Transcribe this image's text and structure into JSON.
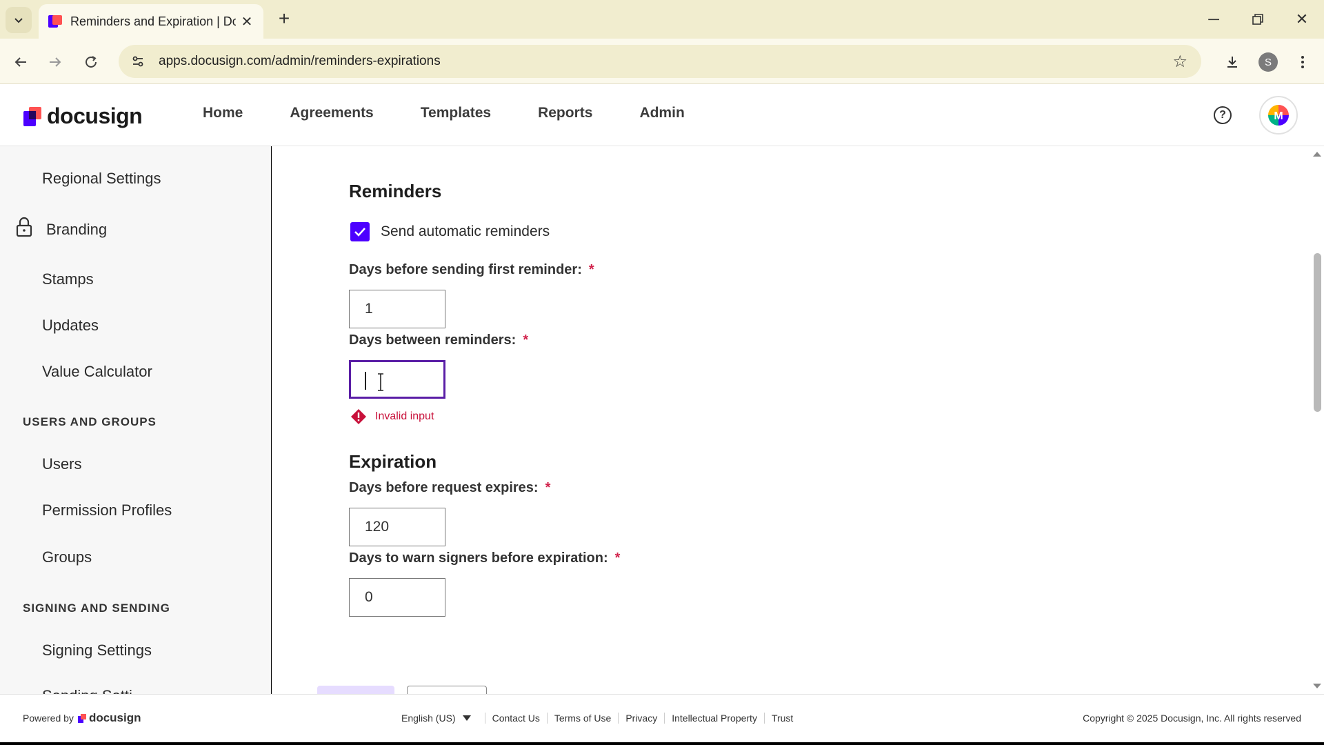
{
  "browser": {
    "tab_title": "Reminders and Expiration | Doc",
    "url": "apps.docusign.com/admin/reminders-expirations",
    "profile_initial": "S"
  },
  "header": {
    "logo_text": "docusign",
    "nav": [
      "Home",
      "Agreements",
      "Templates",
      "Reports",
      "Admin"
    ]
  },
  "sidebar": {
    "items": {
      "regional_settings": "Regional Settings",
      "branding": "Branding",
      "stamps": "Stamps",
      "updates": "Updates",
      "value_calculator": "Value Calculator",
      "users_and_groups_heading": "USERS AND GROUPS",
      "users": "Users",
      "permission_profiles": "Permission Profiles",
      "groups": "Groups",
      "signing_and_sending_heading": "SIGNING AND SENDING",
      "signing_settings": "Signing Settings",
      "sending_settings_partial": "Sending Setti"
    }
  },
  "reminders": {
    "heading": "Reminders",
    "auto_label": "Send automatic reminders",
    "auto_checked": true,
    "first_label": "Days before sending first reminder:",
    "first_value": "1",
    "between_label": "Days between reminders:",
    "between_value": "",
    "error_text": "Invalid input"
  },
  "expiration": {
    "heading": "Expiration",
    "expires_label": "Days before request expires:",
    "expires_value": "120",
    "warn_label": "Days to warn signers before expiration:",
    "warn_value": "0"
  },
  "required_mark": "*",
  "footer": {
    "powered_by": "Powered by",
    "brand": "docusign",
    "language": "English (US)",
    "links": [
      "Contact Us",
      "Terms of Use",
      "Privacy",
      "Intellectual Property",
      "Trust"
    ],
    "copyright": "Copyright © 2025 Docusign, Inc. All rights reserved"
  },
  "colors": {
    "accent": "#4c00ff",
    "focus_border": "#5a1ea6",
    "error": "#c8103a",
    "required": "#d1224b",
    "chrome_tab_bar": "#f1edcf"
  },
  "icons": [
    "tab-search-icon",
    "close-icon",
    "plus-icon",
    "minimize-icon",
    "restore-icon",
    "back-icon",
    "forward-icon",
    "reload-icon",
    "tune-icon",
    "star-icon",
    "download-icon",
    "kebab-menu-icon",
    "help-icon",
    "lock-icon",
    "checkmark-icon",
    "error-diamond-icon",
    "caret-down-icon"
  ]
}
